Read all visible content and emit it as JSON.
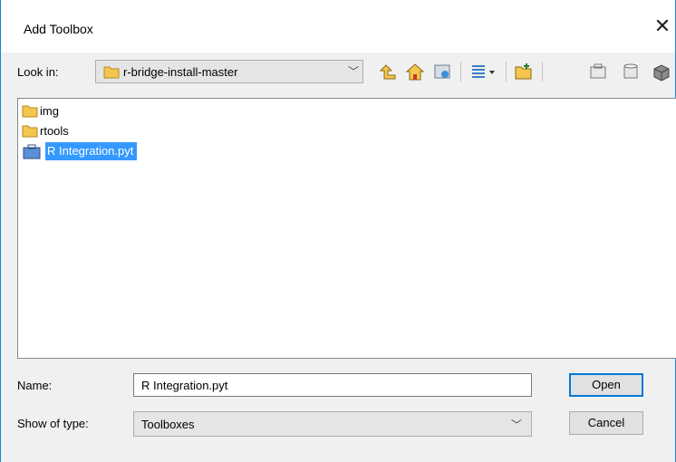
{
  "window": {
    "title": "Add Toolbox",
    "close_glyph": "✕"
  },
  "toolbar": {
    "look_in_label": "Look in:",
    "current_folder": "r-bridge-install-master",
    "buttons": [
      "up-one-level-icon",
      "home-icon",
      "catalog-connect-icon",
      "view-options-icon",
      "new-folder-icon",
      "new-toolbox-icon",
      "new-database-icon",
      "connect-folder-icon"
    ]
  },
  "files": [
    {
      "name": "img",
      "kind": "folder",
      "selected": false
    },
    {
      "name": "rtools",
      "kind": "folder",
      "selected": false
    },
    {
      "name": "R Integration.pyt",
      "kind": "python-toolbox",
      "selected": true
    }
  ],
  "form": {
    "name_label": "Name:",
    "name_value": "R Integration.pyt",
    "type_label": "Show of type:",
    "type_value": "Toolboxes"
  },
  "buttons": {
    "open": "Open",
    "cancel": "Cancel"
  },
  "colors": {
    "selection": "#3399ff",
    "accent": "#0078d7",
    "folder": "#f4c64f"
  }
}
